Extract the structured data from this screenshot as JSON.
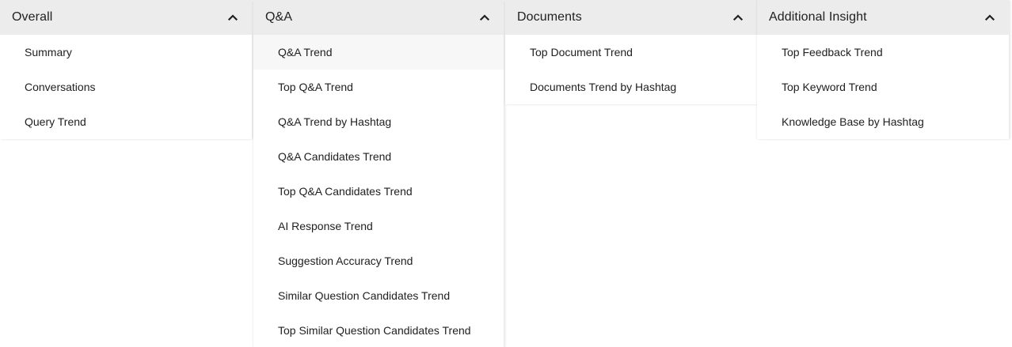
{
  "menus": [
    {
      "title": "Overall",
      "icon": "chevron-up-icon",
      "items": [
        "Summary",
        "Conversations",
        "Query Trend"
      ]
    },
    {
      "title": "Q&A",
      "icon": "chevron-up-icon",
      "items": [
        "Q&A Trend",
        "Top Q&A Trend",
        "Q&A Trend by Hashtag",
        "Q&A Candidates Trend",
        "Top Q&A Candidates Trend",
        "AI Response Trend",
        "Suggestion Accuracy Trend",
        "Similar Question Candidates Trend",
        "Top Similar Question Candidates Trend"
      ]
    },
    {
      "title": "Documents",
      "icon": "chevron-up-icon",
      "items": [
        "Top Document Trend",
        "Documents Trend by Hashtag"
      ]
    },
    {
      "title": "Additional Insight",
      "icon": "chevron-up-icon",
      "items": [
        "Top Feedback Trend",
        "Top Keyword Trend",
        "Knowledge Base by Hashtag"
      ]
    }
  ]
}
